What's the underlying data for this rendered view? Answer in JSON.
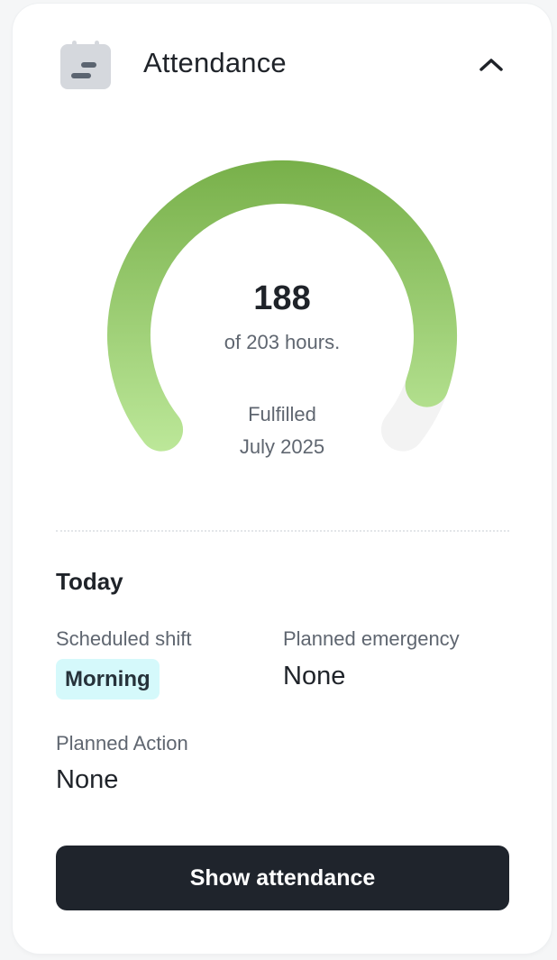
{
  "header": {
    "title": "Attendance",
    "icon": "calendar-icon",
    "toggle_icon": "chevron-up-icon"
  },
  "gauge": {
    "value": "188",
    "total_text": "of 203 hours.",
    "fulfilled": 188,
    "total": 203,
    "status_label": "Fulfilled",
    "period": "July 2025",
    "colors": {
      "fill_top": "#78b04a",
      "fill_bottom": "#bde89a",
      "track": "#f3f3f3"
    }
  },
  "today": {
    "heading": "Today",
    "scheduled_shift": {
      "label": "Scheduled shift",
      "value": "Morning"
    },
    "planned_emergency": {
      "label": "Planned emergency",
      "value": "None"
    },
    "planned_action": {
      "label": "Planned Action",
      "value": "None"
    }
  },
  "actions": {
    "show_attendance": "Show attendance"
  },
  "colors": {
    "badge_bg": "#d5f9fb",
    "button_bg": "#1f242c"
  }
}
